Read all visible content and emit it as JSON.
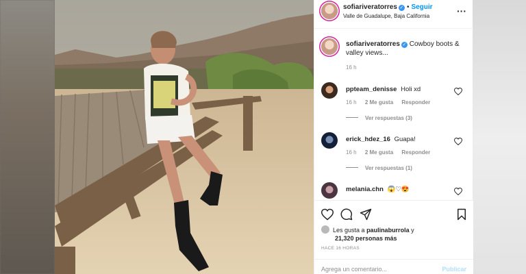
{
  "post": {
    "username": "sofiariveratorres",
    "follow_label": "Seguir",
    "location": "Valle de Guadalupe, Baja California",
    "more_icon": "more-horizontal-icon"
  },
  "caption": {
    "username": "sofiariveratorres",
    "text": "Cowboy boots & valley views...",
    "time": "16 h"
  },
  "comments": [
    {
      "username": "ppteam_denisse",
      "text": "Holi xd",
      "time": "16 h",
      "likes": "2 Me gusta",
      "reply": "Responder",
      "view_replies": "Ver respuestas (3)"
    },
    {
      "username": "erick_hdez_16",
      "text": "Guapa!",
      "time": "16 h",
      "likes": "2 Me gusta",
      "reply": "Responder",
      "view_replies": "Ver respuestas (1)"
    },
    {
      "username": "melania.chn",
      "text": "😱♡😍"
    }
  ],
  "actions": {
    "likes_prefix": "Les gusta a",
    "liked_by": "paulinaburrola",
    "likes_and": "y",
    "others": "21,320 personas más",
    "timestamp": "HACE 16 HORAS"
  },
  "add_comment": {
    "placeholder": "Agrega un comentario...",
    "post_label": "Publicar"
  },
  "colors": {
    "link": "#0095f6",
    "verified": "#3897f0",
    "muted": "#8e8e8e"
  }
}
